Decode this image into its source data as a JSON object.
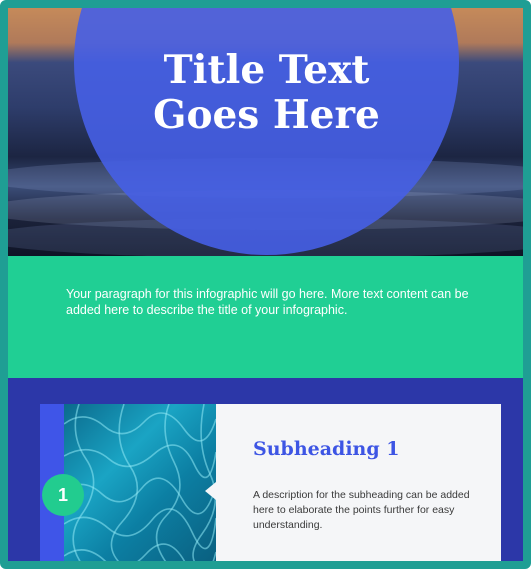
{
  "hero": {
    "title_line1": "Title Text",
    "title_line2": "Goes Here"
  },
  "intro": {
    "paragraph": "Your paragraph for this infographic will go here. More text content can be added here to describe the title of your infographic."
  },
  "item": {
    "number": "1",
    "subheading": "Subheading 1",
    "description": "A description for the subheading can be added here to elaborate the points further for easy understanding."
  },
  "colors": {
    "frame": "#1f9e94",
    "hero_circle": "#465fe6",
    "band": "#20cf94",
    "lower_background": "#2c37a8",
    "accent_blue": "#3d55e4",
    "badge": "#22cc8f"
  },
  "images": {
    "hero_background": "ocean-waves-image",
    "item_photo": "water-ripple-image"
  }
}
